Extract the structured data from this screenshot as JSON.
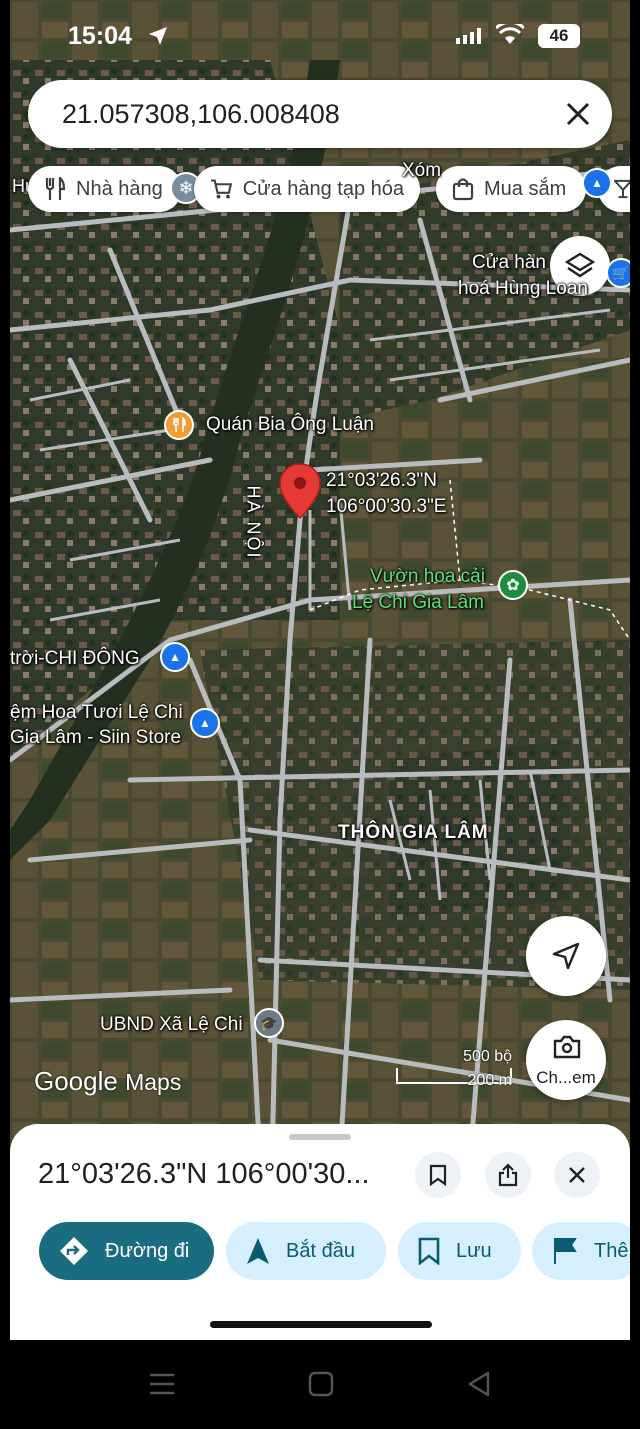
{
  "status_bar": {
    "time": "15:04",
    "battery": "46"
  },
  "search": {
    "value": "21.057308,106.008408"
  },
  "chips": [
    {
      "label": "Nhà hàng",
      "icon": "fork-knife-icon"
    },
    {
      "label": "Cửa hàng tạp hóa",
      "icon": "cart-icon"
    },
    {
      "label": "Mua sắm",
      "icon": "shopping-bag-icon"
    }
  ],
  "map_labels": {
    "quan_bia": "Quán Bia Ông Luận",
    "ha_noi": "HÀ NỘI",
    "pin_lat": "21°03'26.3\"N",
    "pin_lng": "106°00'30.3\"E",
    "vuon_hoa_1": "Vườn hoa cải",
    "vuon_hoa_2": "Lệ Chi Gia Lâm",
    "chi_dong": "trời-CHI ĐÔNG",
    "hoa_tuoi_1": "ệm Hoa Tươi Lệ Chi",
    "hoa_tuoi_2": "Gia Lâm - Siin Store",
    "thon_gia_lam": "THÔN GIA LÂM",
    "ubnd": "UBND Xã Lệ Chi",
    "cua_hang_1": "Cửa hàn",
    "cua_hang_2": "hoá Hùng Loan",
    "xom": "Xóm",
    "hu": "Hu"
  },
  "scale": {
    "top": "500 bộ",
    "bottom": "200 m"
  },
  "branding": {
    "google": "Google",
    "maps": "Maps"
  },
  "fab": {
    "camera_label": "Ch...em"
  },
  "sheet": {
    "title": "21°03'26.3\"N 106°00'30...",
    "actions": [
      {
        "label": "Đường đi",
        "icon": "directions-icon"
      },
      {
        "label": "Bắt đầu",
        "icon": "navigation-icon"
      },
      {
        "label": "Lưu",
        "icon": "bookmark-icon"
      },
      {
        "label": "Thê",
        "icon": "flag-icon"
      }
    ]
  },
  "colors": {
    "accent": "#1a6d80",
    "chip_bg": "#ffffff",
    "action_bg": "#d6efff",
    "pin": "#e53935"
  }
}
